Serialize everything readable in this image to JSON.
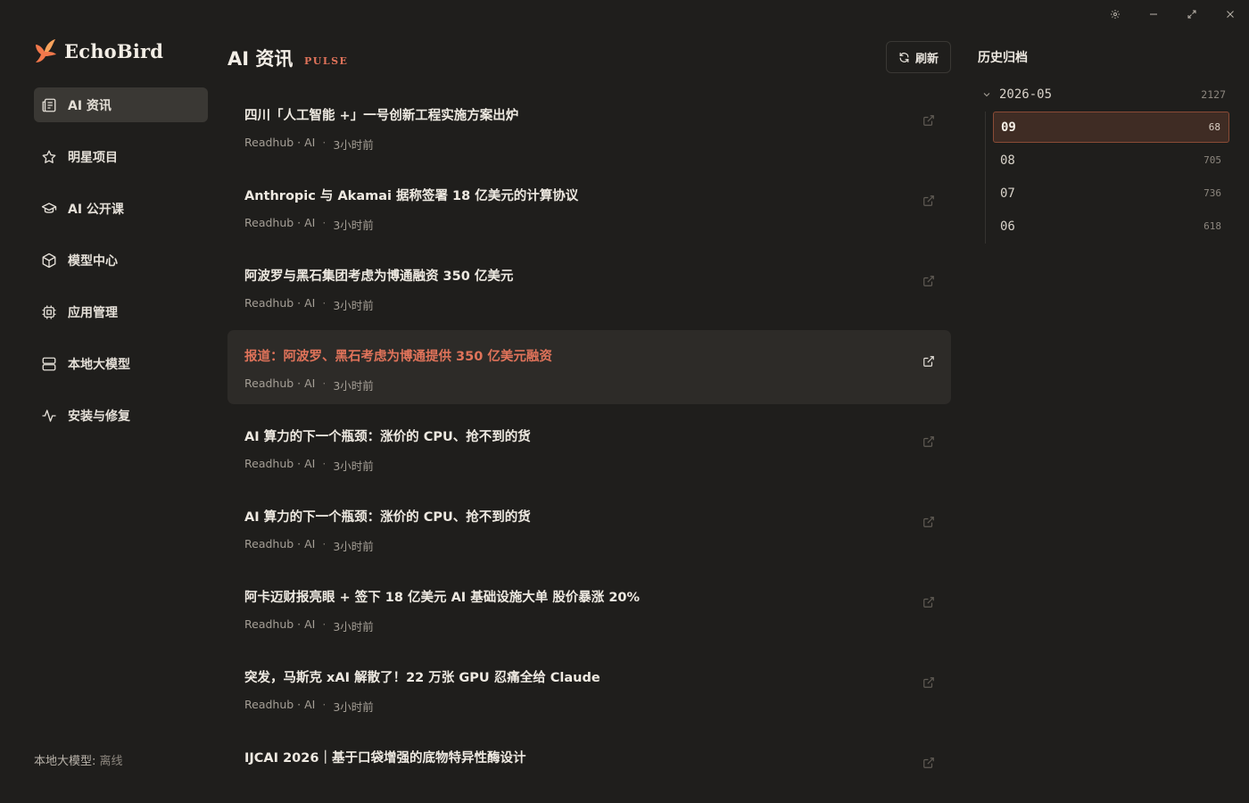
{
  "window": {
    "controls": [
      "gear-icon",
      "minimize-icon",
      "maximize-icon",
      "close-icon"
    ]
  },
  "brand": {
    "name": "EchoBird",
    "accent": "#e0735a"
  },
  "sidebar": {
    "items": [
      {
        "label": "AI 资讯",
        "icon": "newspaper-icon",
        "active": true
      },
      {
        "label": "明星项目",
        "icon": "star-icon"
      },
      {
        "label": "AI 公开课",
        "icon": "graduation-cap-icon"
      },
      {
        "label": "模型中心",
        "icon": "cube-icon"
      },
      {
        "label": "应用管理",
        "icon": "chip-icon"
      },
      {
        "label": "本地大模型",
        "icon": "server-icon"
      },
      {
        "label": "安装与修复",
        "icon": "activity-icon"
      }
    ],
    "local_model_label": "本地大模型:",
    "local_model_status": "离线"
  },
  "main": {
    "title": "AI 资讯",
    "subtitle": "PULSE",
    "refresh_label": "刷新",
    "news": [
      {
        "title": "四川「人工智能 +」一号创新工程实施方案出炉",
        "source": "Readhub · AI",
        "time": "3小时前"
      },
      {
        "title": "Anthropic 与 Akamai 据称签署 18 亿美元的计算协议",
        "source": "Readhub · AI",
        "time": "3小时前"
      },
      {
        "title": "阿波罗与黑石集团考虑为博通融资 350 亿美元",
        "source": "Readhub · AI",
        "time": "3小时前"
      },
      {
        "title": "报道：阿波罗、黑石考虑为博通提供 350 亿美元融资",
        "source": "Readhub · AI",
        "time": "3小时前",
        "active": true
      },
      {
        "title": "AI 算力的下一个瓶颈：涨价的 CPU、抢不到的货",
        "source": "Readhub · AI",
        "time": "3小时前"
      },
      {
        "title": "AI 算力的下一个瓶颈：涨价的 CPU、抢不到的货",
        "source": "Readhub · AI",
        "time": "3小时前"
      },
      {
        "title": "阿卡迈财报亮眼 + 签下 18 亿美元 AI 基础设施大单 股价暴涨 20%",
        "source": "Readhub · AI",
        "time": "3小时前"
      },
      {
        "title": "突发，马斯克 xAI 解散了！22 万张 GPU 忍痛全给 Claude",
        "source": "Readhub · AI",
        "time": "3小时前"
      },
      {
        "title": "IJCAI 2026｜基于口袋增强的底物特异性酶设计",
        "source": "",
        "time": ""
      }
    ]
  },
  "archive": {
    "title": "历史归档",
    "year": {
      "label": "2026-05",
      "count": "2127"
    },
    "months": [
      {
        "label": "09",
        "count": "68",
        "active": true
      },
      {
        "label": "08",
        "count": "705"
      },
      {
        "label": "07",
        "count": "736"
      },
      {
        "label": "06",
        "count": "618"
      }
    ]
  }
}
